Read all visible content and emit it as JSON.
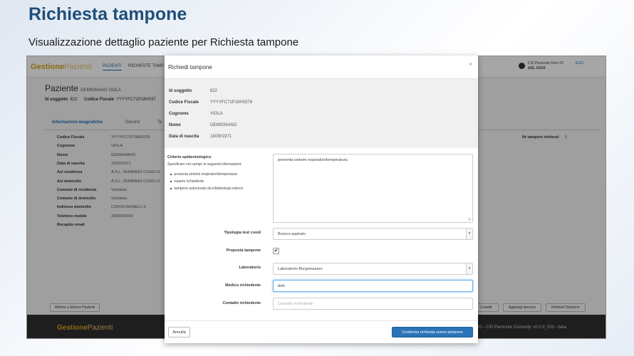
{
  "slide": {
    "title": "Richiesta tampone",
    "subtitle": "Visualizzazione dettaglio paziente per Richiesta tampone"
  },
  "app": {
    "brand_bold": "Gestione",
    "brand_light": "Pazienti",
    "nav": [
      "PAZIENTI",
      "RICHIESTE TAMP"
    ],
    "user_line1": "CSI Piemonte Dem 22",
    "user_line2": "ASL XXXX",
    "logout": "ESCI",
    "page_title": "Paziente",
    "patient_name": "GEMIGNANO VIOLA",
    "id_label": "Id soggetto",
    "id_value": "822",
    "cf_label": "Codice Fiscale",
    "cf_value": "YYYYFC71P18H037",
    "tabs": [
      "Informazioni anagrafiche",
      "Decorsi",
      "Te"
    ],
    "info_rows": [
      {
        "k": "Codice Fiscale",
        "v": "YYYYFC71P18H0378"
      },
      {
        "k": "Cognome",
        "v": "VIOLA"
      },
      {
        "k": "Nome",
        "v": "GEMIGNANO"
      },
      {
        "k": "Data di nascita",
        "v": "18/09/1971"
      },
      {
        "k": "Asl residenza",
        "v": "A.S.L. VERBANO-CUSIO-O"
      },
      {
        "k": "Asl domicilio",
        "v": "A.S.L. VERBANO-CUSIO-O"
      },
      {
        "k": "Comune di residenza",
        "v": "Verbania"
      },
      {
        "k": "Comune di domicilio",
        "v": "Verbania"
      },
      {
        "k": "Indirizzo domicilio",
        "v": "CORSO AGNELLI 5"
      },
      {
        "k": "Telefono mobile",
        "v": "3330000000"
      },
      {
        "k": "Recapito email",
        "v": ""
      }
    ],
    "n_tamponi_label": "Nr tamponi richiesti",
    "n_tamponi_value": "1",
    "btn_back": "Ritorna a Elenco Pazienti",
    "btn_right": [
      "Contatti",
      "Aggiungi decorso",
      "Richiedi Tampone"
    ],
    "footer_brand_bold": "Gestione",
    "footer_brand_light": "Pazienti",
    "footer_text": "20 - CSI Piemonte   Currently: v0.0.9_003 - beta"
  },
  "modal": {
    "title": "Richiedi tampone",
    "close": "×",
    "summary": [
      {
        "k": "Id soggetto",
        "v": "822"
      },
      {
        "k": "Codice Fiscale",
        "v": "YYYYFC71P18H0378"
      },
      {
        "k": "Cognome",
        "v": "VIOLA"
      },
      {
        "k": "Nome",
        "v": "GEMIGNANO"
      },
      {
        "k": "Data di nascita",
        "v": "18/09/1971"
      }
    ],
    "criterio_label": "Criterio epidemiologico",
    "criterio_hint": "Specificare nel campo le seguenti informazioni:",
    "criterio_list": [
      "presenta sintomi respiratori/temperatura",
      "reparto richiedente",
      "tampone autorizzato da infettivologo interno"
    ],
    "criterio_value": "presenta sintomi respiratori/temperatura",
    "tipologia_label": "Tipologia test covid",
    "tipologia_value": "Bronco-aspirato",
    "proposta_label": "Proposta tampone",
    "proposta_check": "✔",
    "laboratorio_label": "Laboratorio",
    "laboratorio_value": "Laboratorio Borgomanero",
    "medico_label": "Medico richiedente",
    "medico_value": "dott.",
    "contatto_label": "Contatto richiedente",
    "contatto_placeholder": "Contatto richiedente",
    "btn_cancel": "Annulla",
    "btn_confirm": "Conferma richiesta nuovo tampone"
  }
}
